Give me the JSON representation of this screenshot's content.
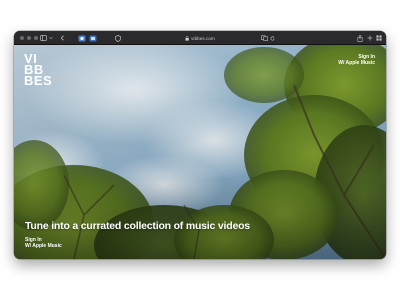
{
  "browser": {
    "url": "vibbes.com",
    "icons": [
      "sidebar-toggle-icon",
      "chevron-left-icon",
      "extension-icon",
      "extension-icon",
      "shield-icon",
      "lock-icon",
      "translate-icon",
      "reload-icon",
      "share-icon",
      "new-tab-icon",
      "tab-overview-icon"
    ]
  },
  "site": {
    "logo_lines": [
      "VI",
      "BB",
      "BES"
    ],
    "signin_top": {
      "line1": "Sign In",
      "line2": "W/ Apple Music"
    },
    "headline": "Tune into a currated collection of music videos",
    "signin_bottom": {
      "line1": "Sign In",
      "line2": "W/ Apple Music"
    }
  },
  "colors": {
    "toolbar": "#2a2a2c",
    "text": "#ffffff",
    "sky": "#8fb0c8",
    "foliage": "#6f8f2a"
  }
}
